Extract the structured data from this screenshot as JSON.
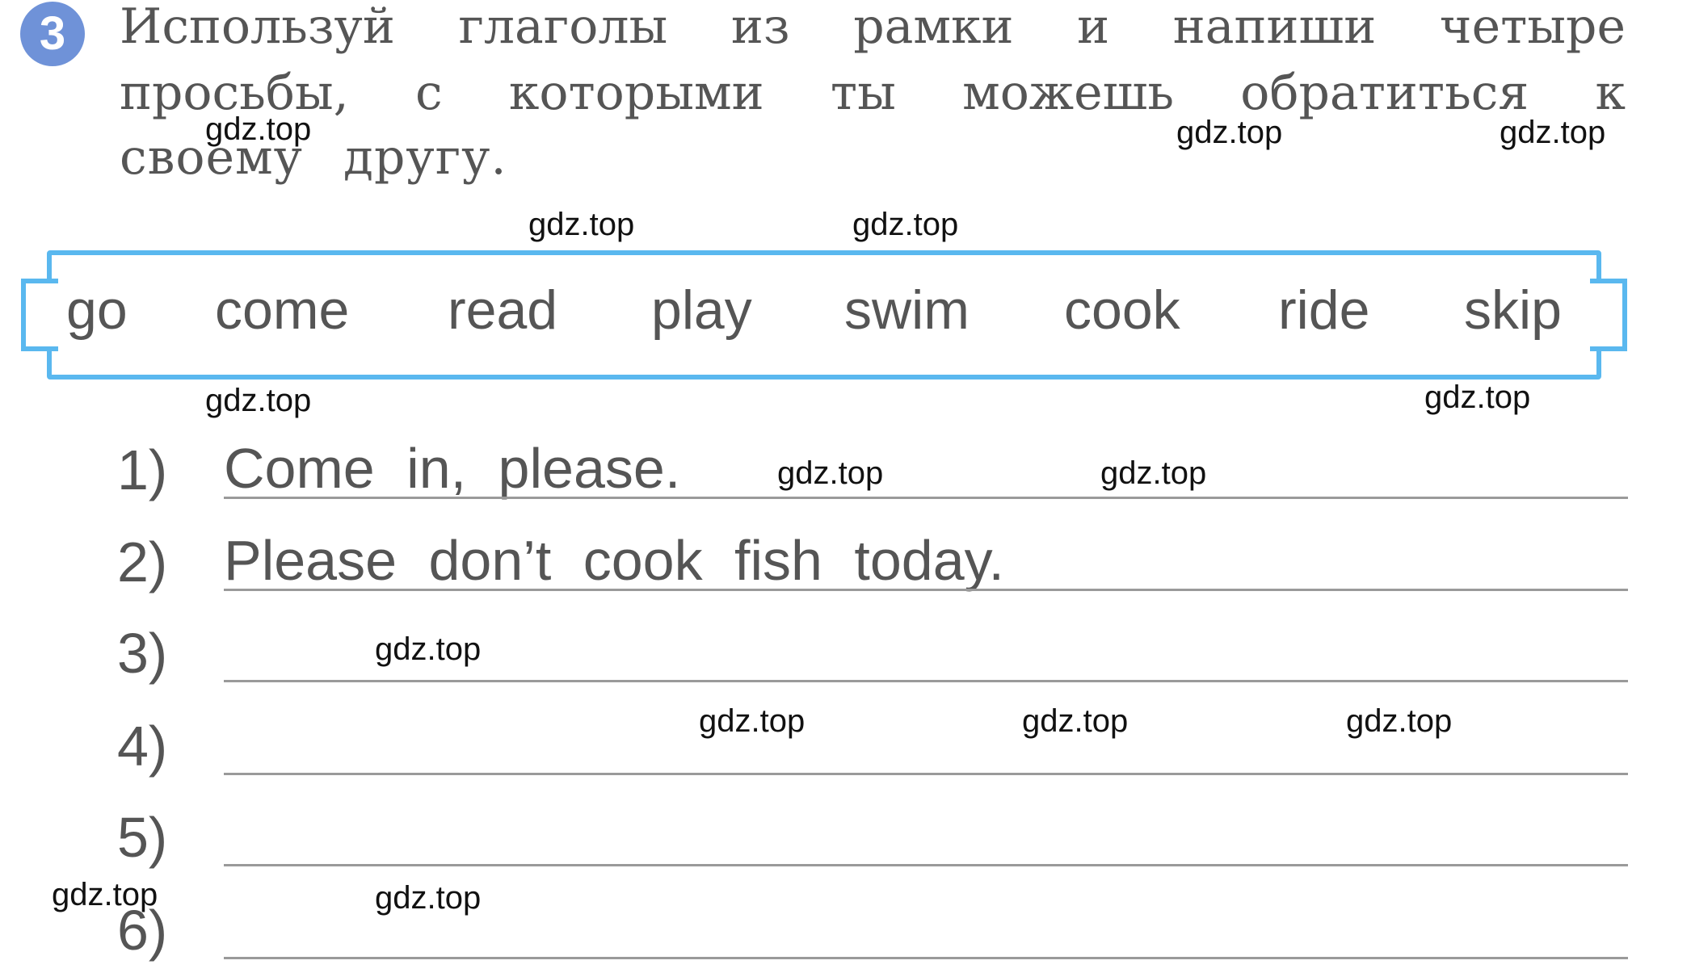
{
  "exercise": {
    "number": "3",
    "instruction_lines": [
      [
        "Используй",
        "глаголы",
        "из",
        "рамки",
        "и",
        "напиши",
        "четыре"
      ],
      [
        "просьбы,",
        "с",
        "которыми",
        "ты",
        "можешь",
        "обратиться",
        "к"
      ],
      [
        "своему другу."
      ]
    ]
  },
  "word_box": {
    "words": [
      "go",
      "come",
      "read",
      "play",
      "swim",
      "cook",
      "ride",
      "skip"
    ],
    "border_color": "#5ab8ef"
  },
  "answers": [
    {
      "number": "1)",
      "text": "Come in, please."
    },
    {
      "number": "2)",
      "text": "Please don’t cook fish today."
    },
    {
      "number": "3)",
      "text": ""
    },
    {
      "number": "4)",
      "text": ""
    },
    {
      "number": "5)",
      "text": ""
    },
    {
      "number": "6)",
      "text": ""
    }
  ],
  "watermark": {
    "text": "gdz.top"
  }
}
